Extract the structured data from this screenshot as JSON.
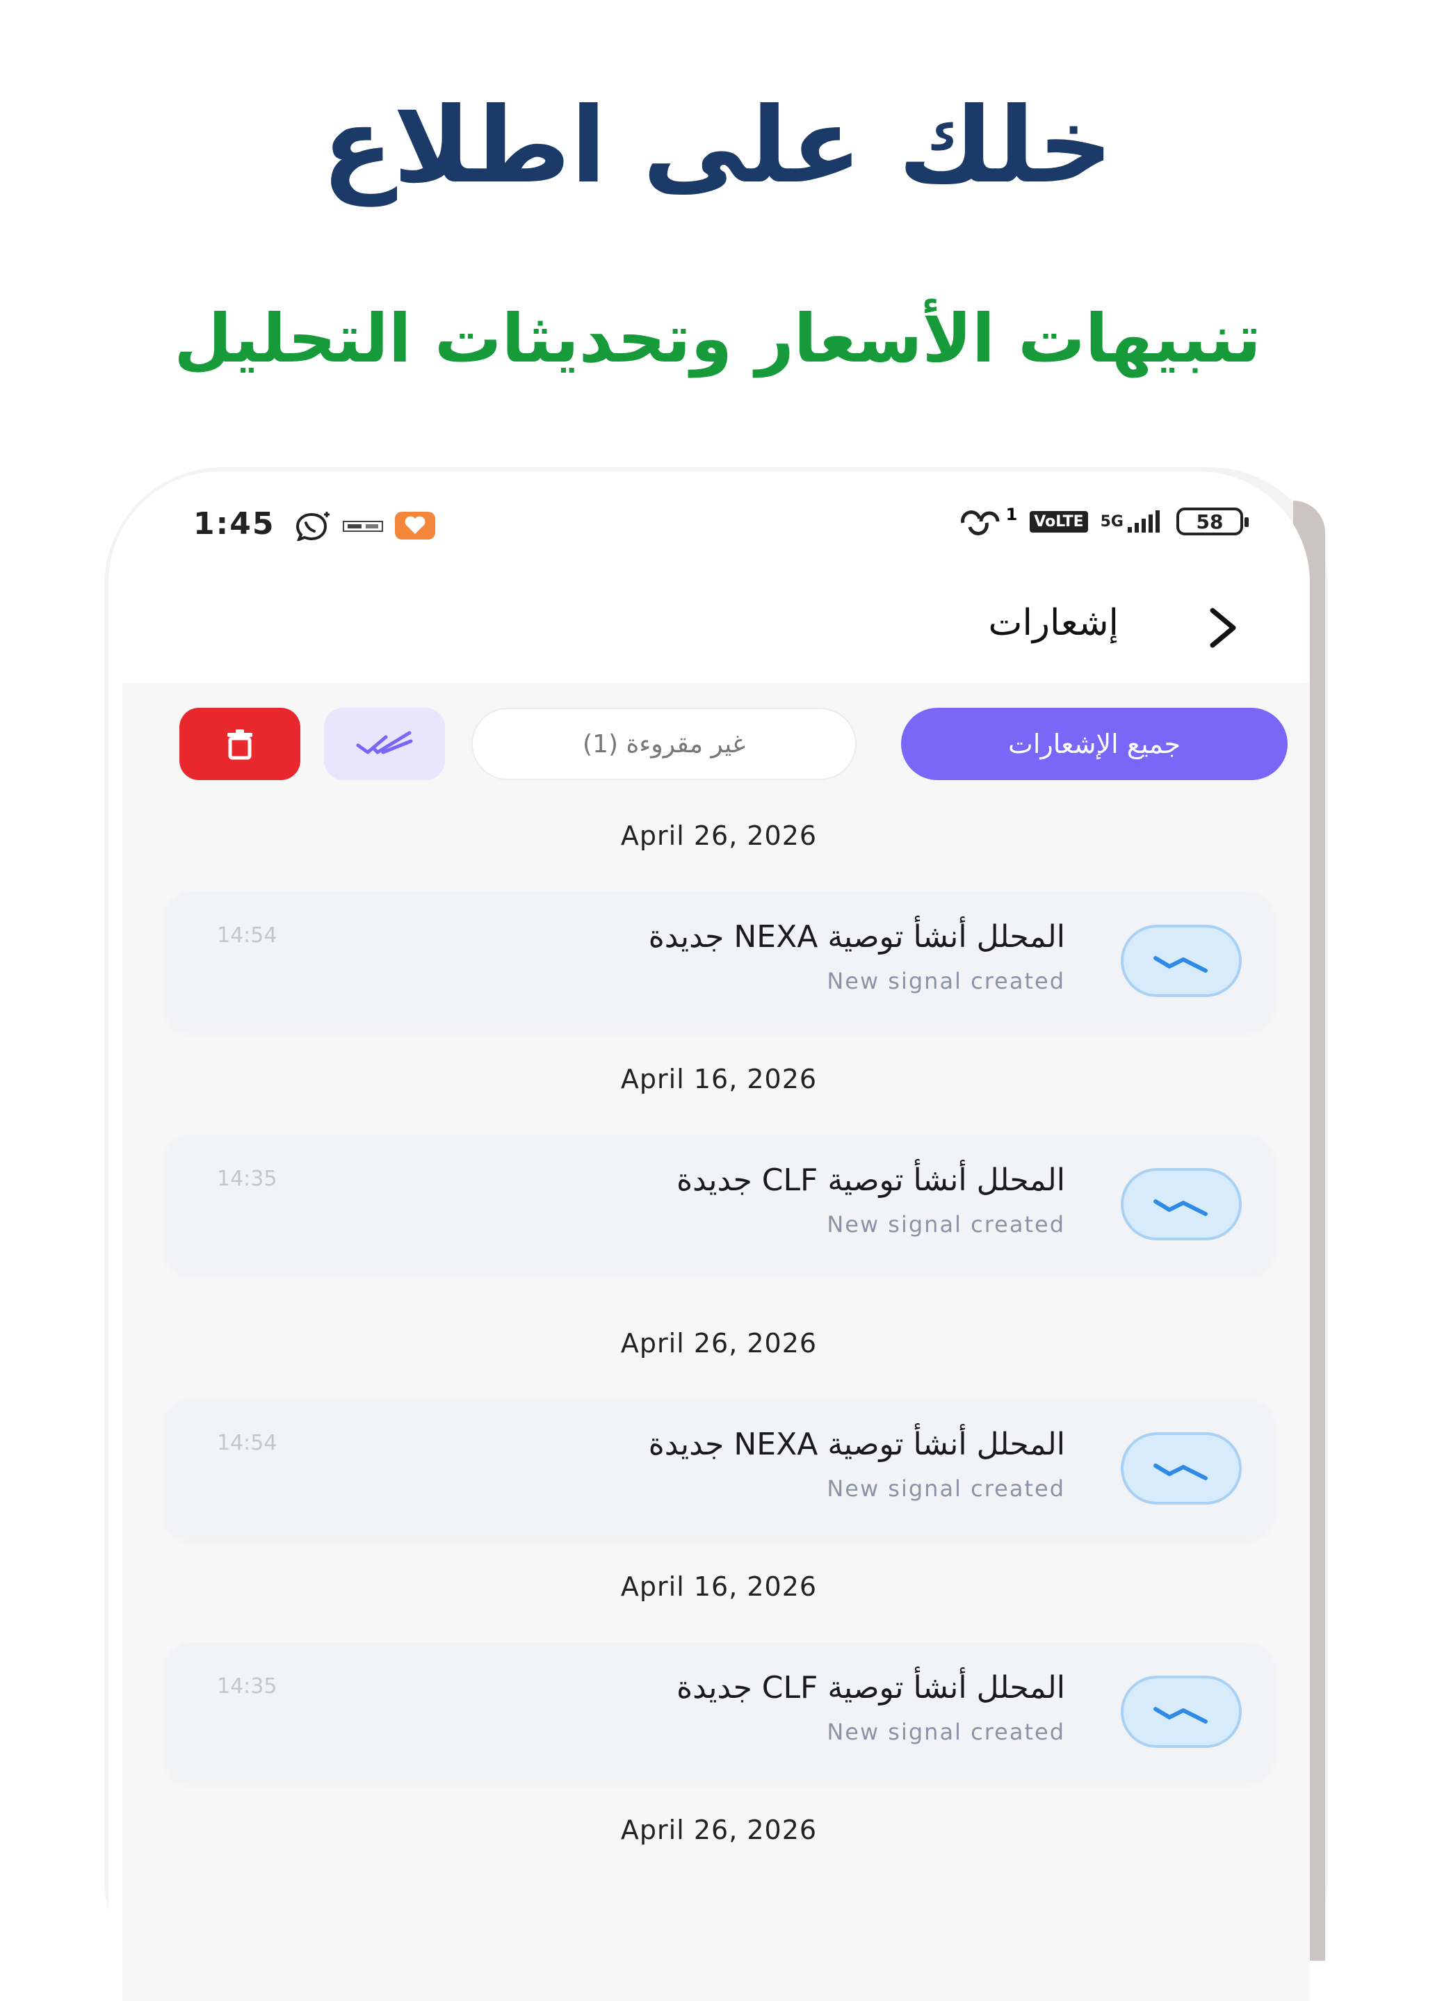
{
  "hero": {
    "headline": "خلك على اطلاع",
    "subline": "تنبيهات الأسعار وتحديثات التحليل"
  },
  "status_bar": {
    "time": "1:45",
    "sim_badge": "1",
    "volte": "VoLTE",
    "network": "5G",
    "battery": "58"
  },
  "header": {
    "title": "إشعارات"
  },
  "filters": {
    "all_label": "جميع الإشعارات",
    "unread_label": "غير مقروءة (1)"
  },
  "colors": {
    "accent": "#7a66f7",
    "delete": "#e8282c",
    "headline": "#1b3a68",
    "subline": "#169a3a"
  },
  "notifications": [
    {
      "date": "April 26, 2026",
      "title": "المحلل أنشأ توصية NEXA جديدة",
      "subtitle": "New signal created",
      "time": "14:54",
      "icon": "trend-down-icon"
    },
    {
      "date": "April 16, 2026",
      "title": "المحلل أنشأ توصية CLF جديدة",
      "subtitle": "New signal created",
      "time": "14:35",
      "icon": "trend-down-icon"
    },
    {
      "date": "April 26, 2026",
      "title": "المحلل أنشأ توصية NEXA جديدة",
      "subtitle": "New signal created",
      "time": "14:54",
      "icon": "trend-down-icon"
    },
    {
      "date": "April 16, 2026",
      "title": "المحلل أنشأ توصية CLF جديدة",
      "subtitle": "New signal created",
      "time": "14:35",
      "icon": "trend-down-icon"
    }
  ],
  "trailing_date": "April 26, 2026"
}
